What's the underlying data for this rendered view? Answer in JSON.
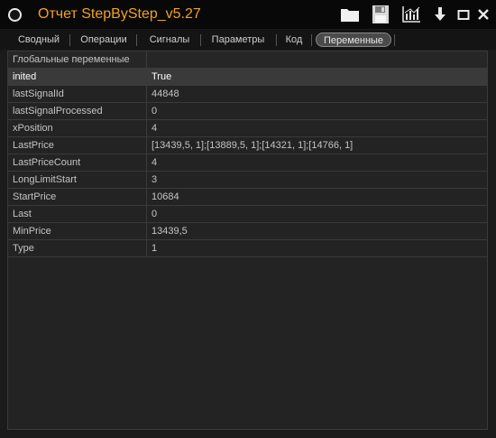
{
  "window": {
    "title": "Отчет StepByStep_v5.27"
  },
  "tabs": [
    {
      "label": "Сводный",
      "active": false
    },
    {
      "label": "Операции",
      "active": false
    },
    {
      "label": "Сигналы",
      "active": false
    },
    {
      "label": "Параметры",
      "active": false
    },
    {
      "label": "Код",
      "active": false
    },
    {
      "label": "Переменные",
      "active": true
    }
  ],
  "table": {
    "group_header": "Глобальные переменные",
    "selected_row": 0,
    "rows": [
      {
        "name": "inited",
        "value": "True"
      },
      {
        "name": "lastSignalId",
        "value": "44848"
      },
      {
        "name": "lastSignalProcessed",
        "value": "0"
      },
      {
        "name": "xPosition",
        "value": "4"
      },
      {
        "name": "LastPrice",
        "value": "[13439,5, 1];[13889,5, 1];[14321, 1];[14766, 1]"
      },
      {
        "name": "LastPriceCount",
        "value": "4"
      },
      {
        "name": "LongLimitStart",
        "value": "3"
      },
      {
        "name": "StartPrice",
        "value": "10684"
      },
      {
        "name": "Last",
        "value": "0"
      },
      {
        "name": "MinPrice",
        "value": "13439,5"
      },
      {
        "name": "Type",
        "value": "1"
      }
    ]
  },
  "icons": {
    "app": "circle-app-icon",
    "open": "folder-icon",
    "save": "floppy-disk-icon",
    "chart": "chart-icon",
    "export": "arrow-down-icon",
    "minimize": "minimize-icon",
    "close": "close-icon"
  },
  "colors": {
    "title": "#f2a21c",
    "background": "#1b1b1b",
    "selected_row": "#3a3a3a"
  }
}
